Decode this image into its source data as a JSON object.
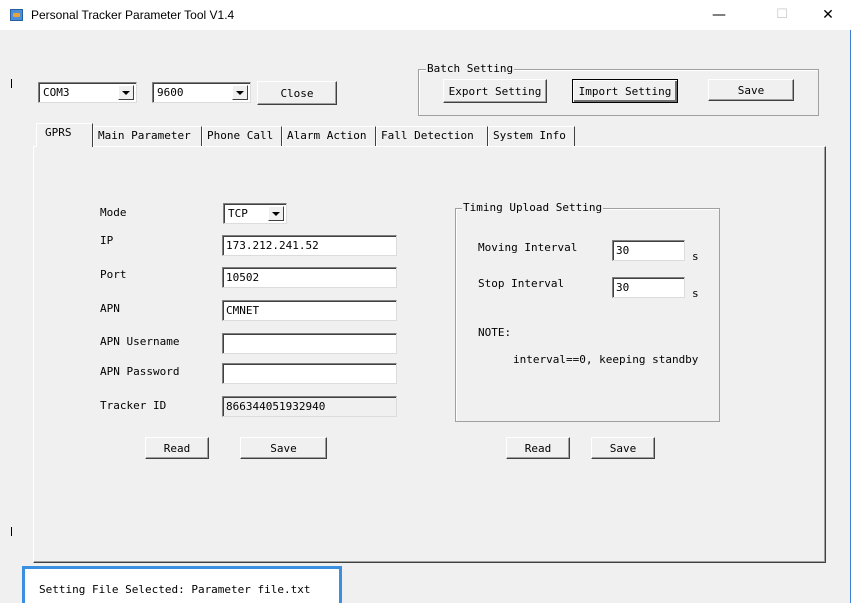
{
  "window": {
    "title": "Personal Tracker Parameter Tool V1.4",
    "minimize_glyph": "—",
    "maximize_glyph": "☐",
    "close_glyph": "✕"
  },
  "toolbar": {
    "port": "COM3",
    "baud": "9600",
    "close_label": "Close"
  },
  "batch": {
    "title": "Batch Setting",
    "export_label": "Export Setting",
    "import_label": "Import Setting",
    "save_label": "Save"
  },
  "tabs": [
    {
      "label": "GPRS",
      "active": true
    },
    {
      "label": "Main Parameter"
    },
    {
      "label": "Phone Call"
    },
    {
      "label": "Alarm Action"
    },
    {
      "label": "Fall Detection"
    },
    {
      "label": "System Info"
    }
  ],
  "gprs": {
    "mode_label": "Mode",
    "mode_value": "TCP",
    "ip_label": "IP",
    "ip_value": "173.212.241.52",
    "port_label": "Port",
    "port_value": "10502",
    "apn_label": "APN",
    "apn_value": "CMNET",
    "apn_user_label": "APN Username",
    "apn_user_value": "",
    "apn_pass_label": "APN Password",
    "apn_pass_value": "",
    "tracker_label": "Tracker ID",
    "tracker_value": "866344051932940",
    "read_label": "Read",
    "save_label": "Save"
  },
  "timing": {
    "title": "Timing Upload Setting",
    "moving_label": "Moving Interval",
    "moving_value": "30",
    "moving_unit": "s",
    "stop_label": "Stop Interval",
    "stop_value": "30",
    "stop_unit": "s",
    "note_label": "NOTE:",
    "note_text": "interval==0, keeping standby",
    "read_label": "Read",
    "save_label": "Save"
  },
  "status": {
    "text": "Setting File Selected: Parameter file.txt"
  },
  "colors": {
    "window_bg": "#f0f0f0",
    "accent_border": "#3a8fe0"
  },
  "icons": {
    "app": "app-icon",
    "dropdown": "chevron-down-icon"
  }
}
